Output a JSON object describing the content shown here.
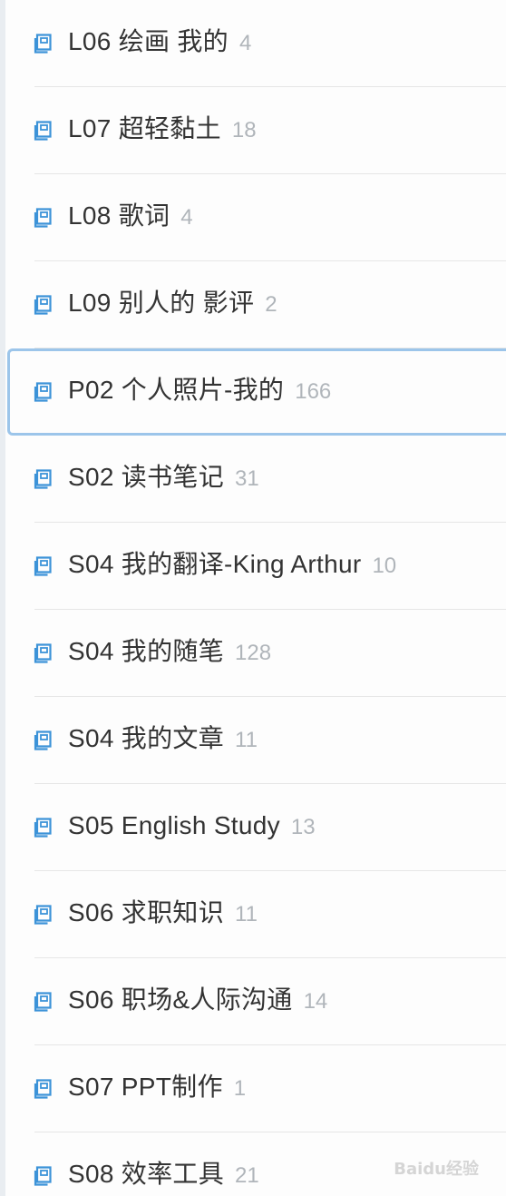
{
  "colors": {
    "icon": "#3c93d8",
    "label": "#333333",
    "count": "#b0b5ba",
    "selected_border": "#9cc5ea",
    "divider": "#e6e6e6"
  },
  "notebooks": [
    {
      "name": "L06 绘画 我的",
      "count": "4",
      "icon": "notebook-icon",
      "selected": false
    },
    {
      "name": "L07 超轻黏土",
      "count": "18",
      "icon": "notebook-icon",
      "selected": false
    },
    {
      "name": "L08 歌词",
      "count": "4",
      "icon": "notebook-icon",
      "selected": false
    },
    {
      "name": "L09 别人的 影评",
      "count": "2",
      "icon": "notebook-icon",
      "selected": false
    },
    {
      "name": "P02 个人照片-我的",
      "count": "166",
      "icon": "notebook-icon",
      "selected": true
    },
    {
      "name": "S02 读书笔记",
      "count": "31",
      "icon": "notebook-icon",
      "selected": false
    },
    {
      "name": "S04 我的翻译-King Arthur",
      "count": "10",
      "icon": "notebook-icon",
      "selected": false
    },
    {
      "name": "S04 我的随笔",
      "count": "128",
      "icon": "notebook-icon",
      "selected": false
    },
    {
      "name": "S04 我的文章",
      "count": "11",
      "icon": "notebook-icon",
      "selected": false
    },
    {
      "name": "S05 English Study",
      "count": "13",
      "icon": "notebook-icon",
      "selected": false
    },
    {
      "name": "S06 求职知识",
      "count": "11",
      "icon": "notebook-icon",
      "selected": false
    },
    {
      "name": "S06 职场&人际沟通",
      "count": "14",
      "icon": "notebook-icon",
      "selected": false
    },
    {
      "name": "S07 PPT制作",
      "count": "1",
      "icon": "notebook-icon",
      "selected": false
    },
    {
      "name": "S08 效率工具",
      "count": "21",
      "icon": "notebook-icon",
      "selected": false
    }
  ],
  "watermark": "Baidu经验"
}
